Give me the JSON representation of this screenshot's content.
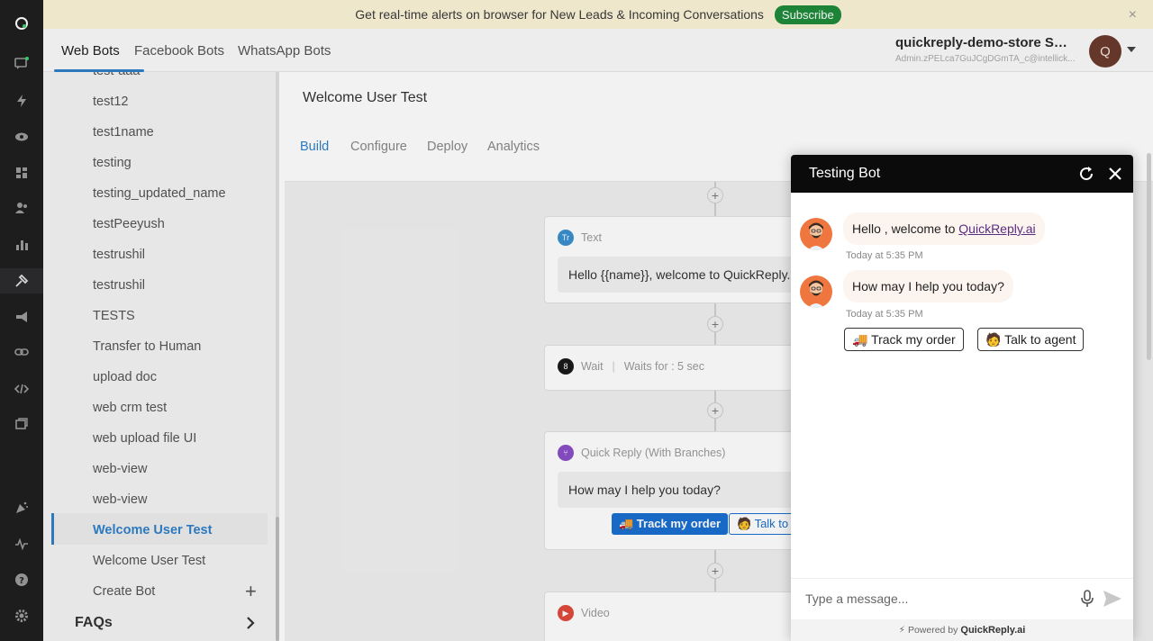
{
  "banner": {
    "text": "Get real-time alerts on browser for New Leads & Incoming Conversations",
    "subscribe_label": "Subscribe",
    "close_glyph": "×"
  },
  "topnav": {
    "tabs": [
      {
        "label": "Web Bots"
      },
      {
        "label": "Facebook Bots"
      },
      {
        "label": "WhatsApp Bots"
      }
    ],
    "store_name": "quickreply-demo-store Sup...",
    "store_sub": "Admin.zPELca7GuJCgDGmTA_c@intellick...",
    "avatar_letter": "Q"
  },
  "sidebar": {
    "items": [
      {
        "label": "test-aaa"
      },
      {
        "label": "test12"
      },
      {
        "label": "test1name"
      },
      {
        "label": "testing"
      },
      {
        "label": "testing_updated_name"
      },
      {
        "label": "testPeeyush"
      },
      {
        "label": "testrushil"
      },
      {
        "label": "testrushil"
      },
      {
        "label": "TESTS"
      },
      {
        "label": "Transfer to Human"
      },
      {
        "label": "upload doc"
      },
      {
        "label": "web crm test"
      },
      {
        "label": "web upload file UI"
      },
      {
        "label": "web-view"
      },
      {
        "label": "web-view"
      },
      {
        "label": "Welcome User Test"
      },
      {
        "label": "Welcome User Test"
      }
    ],
    "create_bot_label": "Create Bot",
    "faqs_label": "FAQs"
  },
  "main": {
    "title": "Welcome User Test",
    "tabs": [
      {
        "label": "Build"
      },
      {
        "label": "Configure"
      },
      {
        "label": "Deploy"
      },
      {
        "label": "Analytics"
      }
    ],
    "nodes": {
      "text": {
        "type_label": "Text",
        "badge": "Tr",
        "content": "Hello {{name}}, welcome to QuickReply.ai"
      },
      "wait": {
        "type_label": "Wait",
        "badge": "8",
        "detail": "Waits for : 5 sec"
      },
      "quick_reply": {
        "type_label": "Quick Reply (With Branches)",
        "content": "How may I help you today?",
        "buttons": [
          {
            "label": "🚚 Track my order"
          },
          {
            "label": "🧑 Talk to ag"
          }
        ]
      },
      "video": {
        "type_label": "Video"
      }
    }
  },
  "widget": {
    "title": "Testing Bot",
    "messages": [
      {
        "text_prefix": "Hello , welcome to ",
        "link": "QuickReply.ai",
        "time": "Today at 5:35 PM"
      },
      {
        "text": "How may I help you today?",
        "time": "Today at 5:35 PM"
      }
    ],
    "quick_replies": [
      {
        "label": "🚚 Track my order"
      },
      {
        "label": "🧑 Talk to agent"
      }
    ],
    "input_placeholder": "Type a message...",
    "powered_prefix": "⚡ Powered by",
    "powered_brand": "QuickReply.ai"
  },
  "colors": {
    "accent": "#2f80c9",
    "banner_bg": "#fcf4d7",
    "subscribe_green": "#1f8b3a",
    "rail_bg": "#1f1f20",
    "widget_header": "#0b0b0b",
    "bot_avatar": "#f0763f"
  },
  "icons": {
    "rail": [
      "logo-icon",
      "chat-icon",
      "bolt-icon",
      "eye-icon",
      "dashboard-icon",
      "users-icon",
      "bar-chart-icon",
      "bot-builder-icon",
      "megaphone-icon",
      "link-icon",
      "code-icon",
      "window-icon",
      "party-icon",
      "pulse-icon",
      "help-icon",
      "settings-icon"
    ]
  }
}
